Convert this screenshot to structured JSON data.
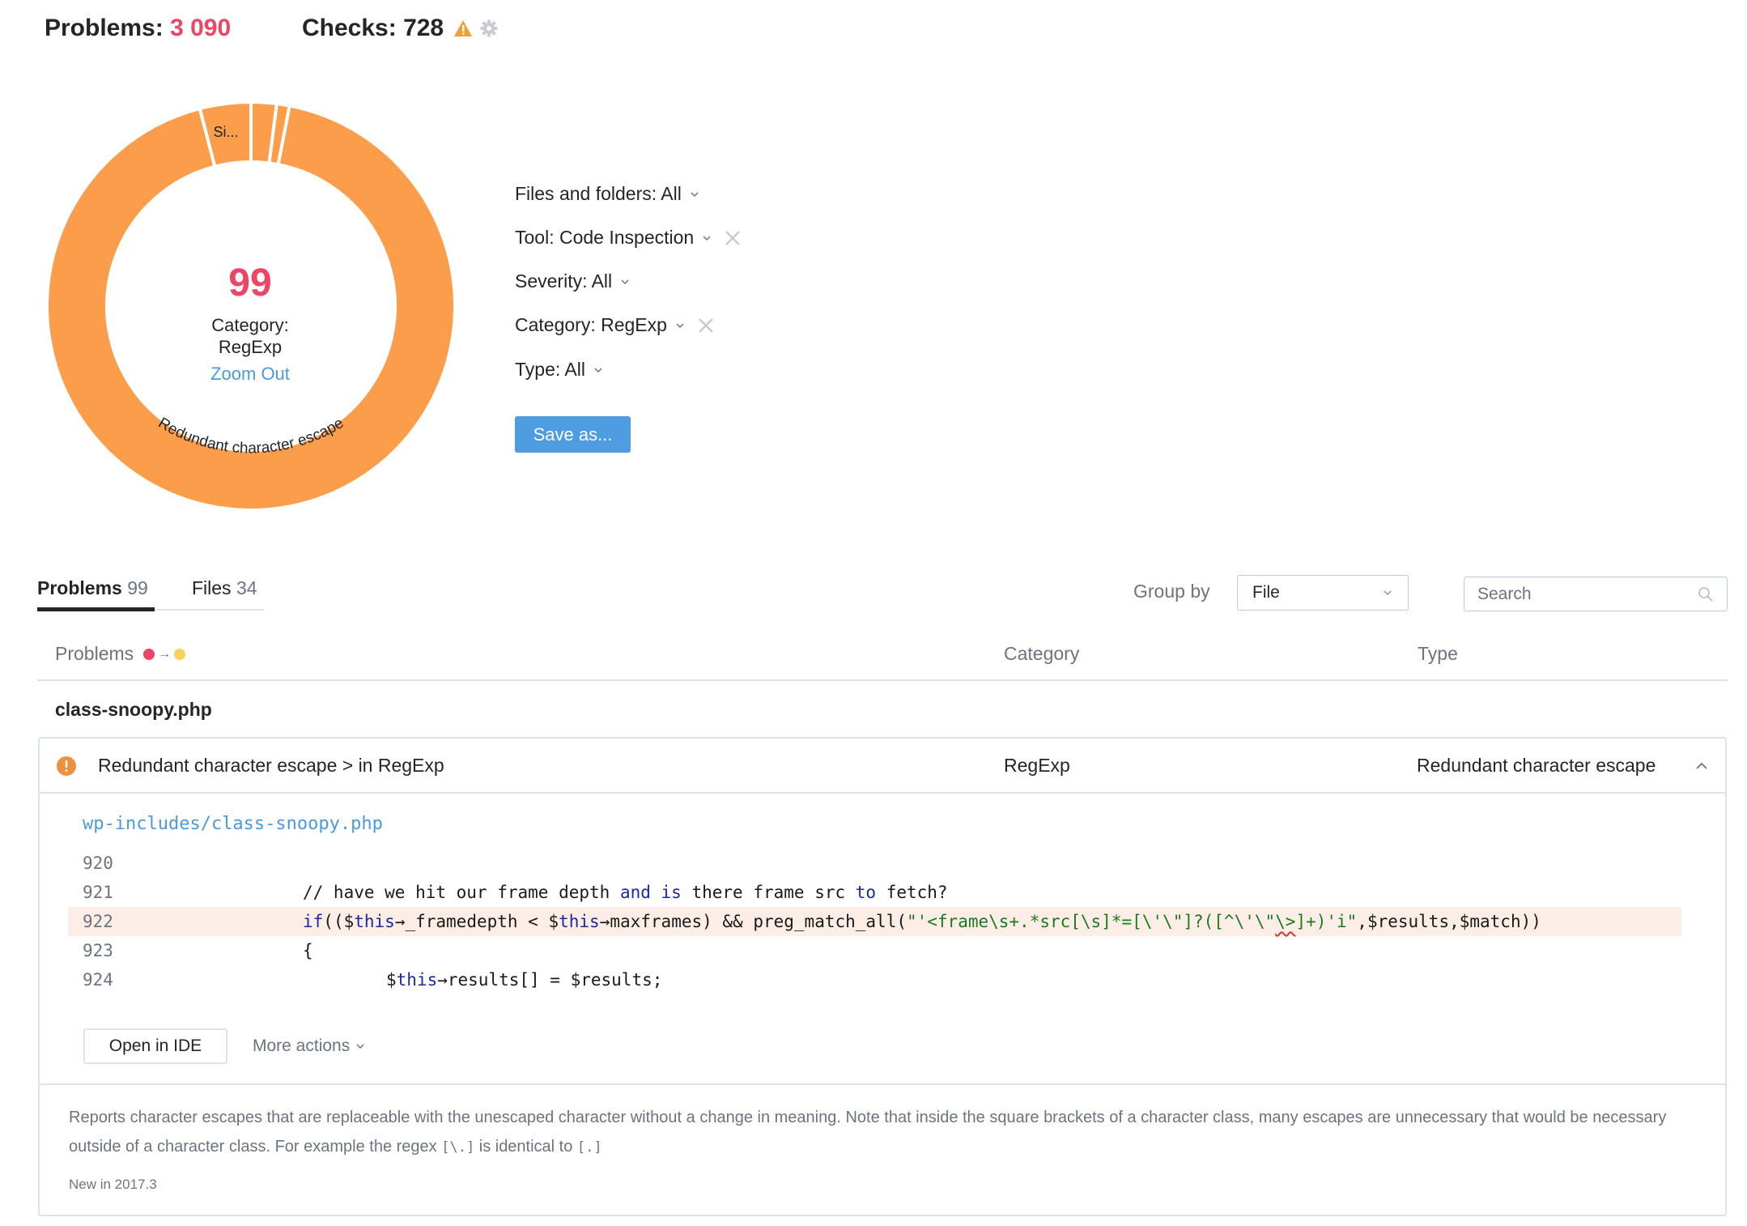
{
  "header": {
    "problems_label": "Problems:",
    "problems_count": "3 090",
    "checks_label": "Checks:",
    "checks_count": "728",
    "warning_icon": "warning-triangle-icon",
    "settings_icon": "gear-icon",
    "colors": {
      "problems_count": "#ee4466",
      "warning": "#f0a030",
      "gear": "#c8ccd2"
    }
  },
  "chart_data": {
    "type": "pie",
    "variant": "donut",
    "title": "",
    "center": {
      "value": "99",
      "label_line1": "Category:",
      "label_line2": "RegExp",
      "link": "Zoom Out"
    },
    "slices": [
      {
        "name": "Redundant character escape",
        "label": "Redundant character escape",
        "value": 92
      },
      {
        "name": "Si...",
        "label": "Si...",
        "value": 4
      },
      {
        "name": "",
        "label": "",
        "value": 2
      },
      {
        "name": "",
        "label": "",
        "value": 1
      }
    ],
    "start_slice_order_note": "clockwise from small slices at top",
    "color": "#fb9d4a"
  },
  "filters": [
    {
      "label": "Files and folders: All",
      "removable": false
    },
    {
      "label": "Tool: Code Inspection",
      "removable": true
    },
    {
      "label": "Severity: All",
      "removable": false
    },
    {
      "label": "Category: RegExp",
      "removable": true
    },
    {
      "label": "Type: All",
      "removable": false
    }
  ],
  "save_button": "Save as...",
  "tabs": [
    {
      "label": "Problems",
      "count": "99",
      "active": true
    },
    {
      "label": "Files",
      "count": "34",
      "active": false
    }
  ],
  "group_by": {
    "label": "Group by",
    "value": "File"
  },
  "search": {
    "placeholder": "Search",
    "value": ""
  },
  "table": {
    "columns": [
      "Problems",
      "Category",
      "Type"
    ],
    "severity_from_color": "#ee4466",
    "severity_to_color": "#fcd25a",
    "groups": [
      {
        "file": "class-snoopy.php",
        "problems": [
          {
            "title": "Redundant character escape > in RegExp",
            "category": "RegExp",
            "type": "Redundant character escape",
            "expanded": true,
            "path": "wp-includes/class-snoopy.php",
            "code": [
              {
                "line": "920",
                "text": ""
              },
              {
                "line": "921",
                "text": "// have we hit our frame depth and is there frame src to fetch?"
              },
              {
                "line": "922",
                "text": "if(($this→_framedepth < $this→maxframes) && preg_match_all(\"'<frame\\s+.*src[\\s]*=[\\'\\\"]?([^\\'\\\"\\>]+)'i\",$results,$match))",
                "highlighted": true
              },
              {
                "line": "923",
                "text": "{"
              },
              {
                "line": "924",
                "text": "$this→results[] = $results;"
              }
            ],
            "actions": {
              "open_in_ide": "Open in IDE",
              "more_actions": "More actions"
            },
            "description": {
              "part1": "Reports character escapes that are replaceable with the unescaped character without a change in meaning. Note that inside the square brackets of a character class, many escapes are unnecessary that would be necessary outside of a character class. For example the regex ",
              "code1": "[\\.]",
              "part2": " is identical to ",
              "code2": "[.]"
            },
            "since": "New in 2017.3"
          }
        ]
      }
    ]
  }
}
